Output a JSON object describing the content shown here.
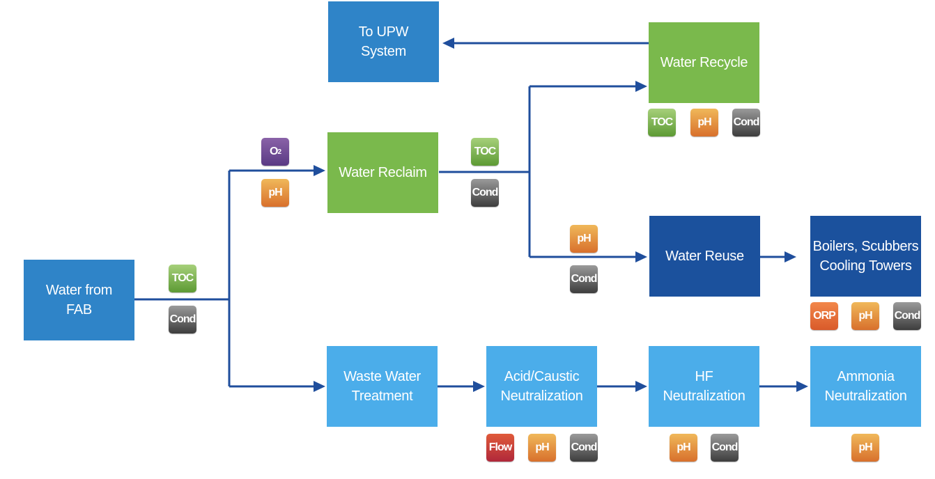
{
  "boxes": {
    "upw": "To UPW\nSystem",
    "recycle": "Water Recycle",
    "reclaim": "Water Reclaim",
    "reuse": "Water Reuse",
    "boilers": "Boilers, Scubbers\nCooling Towers",
    "fab": "Water from\nFAB",
    "waste": "Waste Water\nTreatment",
    "acid": "Acid/Caustic\nNeutralization",
    "hf": "HF\nNeutralization",
    "ammonia": "Ammonia\nNeutralization"
  },
  "badges": {
    "toc": "TOC",
    "ph": "pH",
    "cond": "Cond",
    "o2": "O",
    "o2_sub": "2",
    "flow": "Flow",
    "orp": "ORP"
  },
  "colors": {
    "line": "#1f4e9c",
    "mid_blue": "#2f84c8",
    "green": "#7ab94c",
    "dark_blue": "#1b519d",
    "light_blue": "#4badea"
  }
}
